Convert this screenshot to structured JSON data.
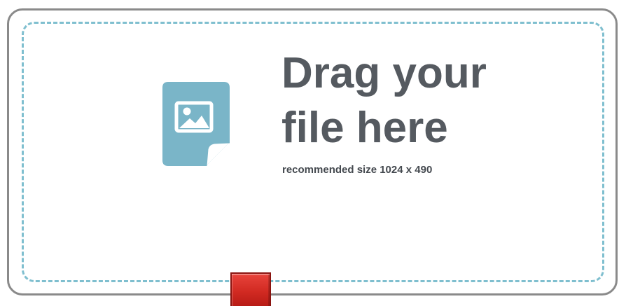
{
  "upload": {
    "headline_line1": "Drag your",
    "headline_line2": "file here",
    "recommendation": "recommended size 1024 x 490",
    "icon": "image-file-icon"
  },
  "colors": {
    "frame_border": "#8a8a8a",
    "dashed_border": "#7fbfcf",
    "icon_fill": "#7ab5c8",
    "headline_text": "#555a60",
    "handle": "#d22a22"
  }
}
